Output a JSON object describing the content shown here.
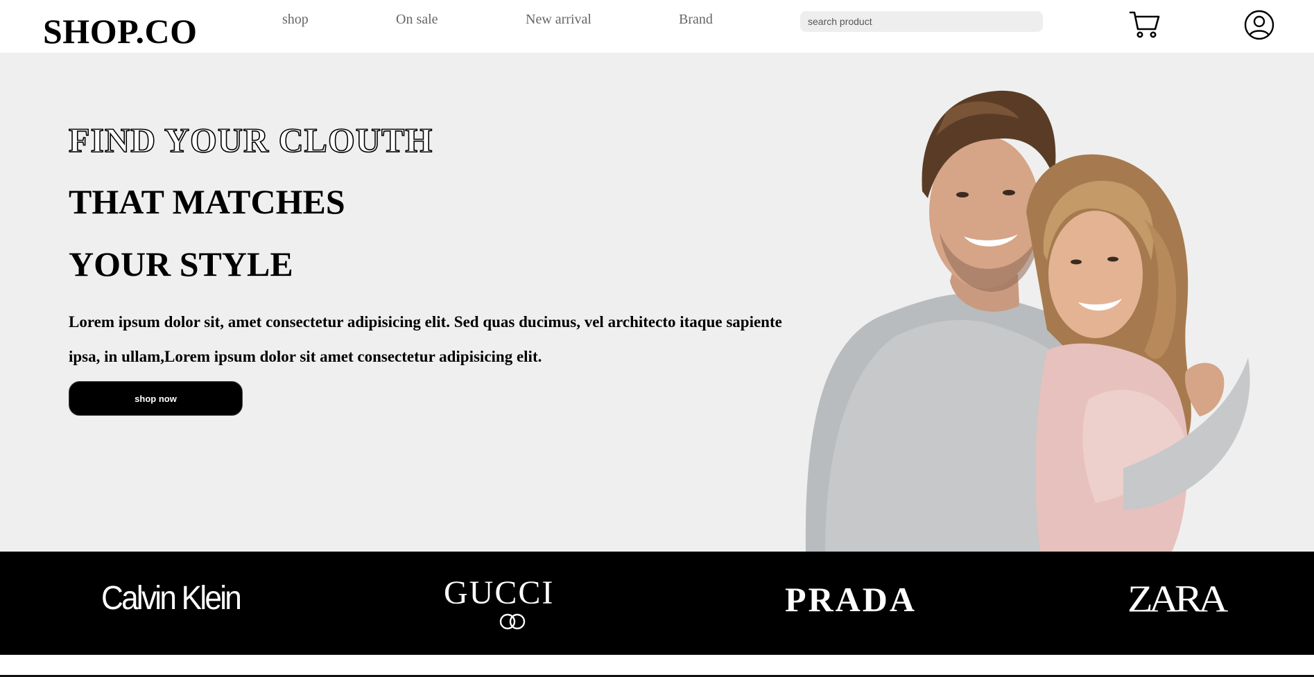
{
  "header": {
    "logo": "SHOP.CO",
    "nav": [
      {
        "label": "shop"
      },
      {
        "label": "On sale"
      },
      {
        "label": "New arrival"
      },
      {
        "label": "Brand"
      }
    ],
    "search": {
      "placeholder": "search product",
      "value": ""
    },
    "icons": {
      "cart": "cart-icon",
      "user": "user-icon"
    }
  },
  "hero": {
    "headline": [
      "FIND YOUR CLOUTH",
      "THAT MATCHES",
      "YOUR STYLE"
    ],
    "description": "Lorem ipsum dolor sit, amet consectetur adipisicing elit. Sed quas ducimus, vel architecto itaque sapiente ipsa, in ullam,Lorem ipsum dolor sit amet consectetur adipisicing elit.",
    "cta_label": "shop now"
  },
  "brands": [
    "Calvin Klein",
    "GUCCI",
    "PRADA",
    "ZARA"
  ],
  "colors": {
    "hero_bg": "#efefef",
    "brand_strip_bg": "#000000",
    "button_bg": "#000000",
    "search_bg": "#eeeeee"
  }
}
